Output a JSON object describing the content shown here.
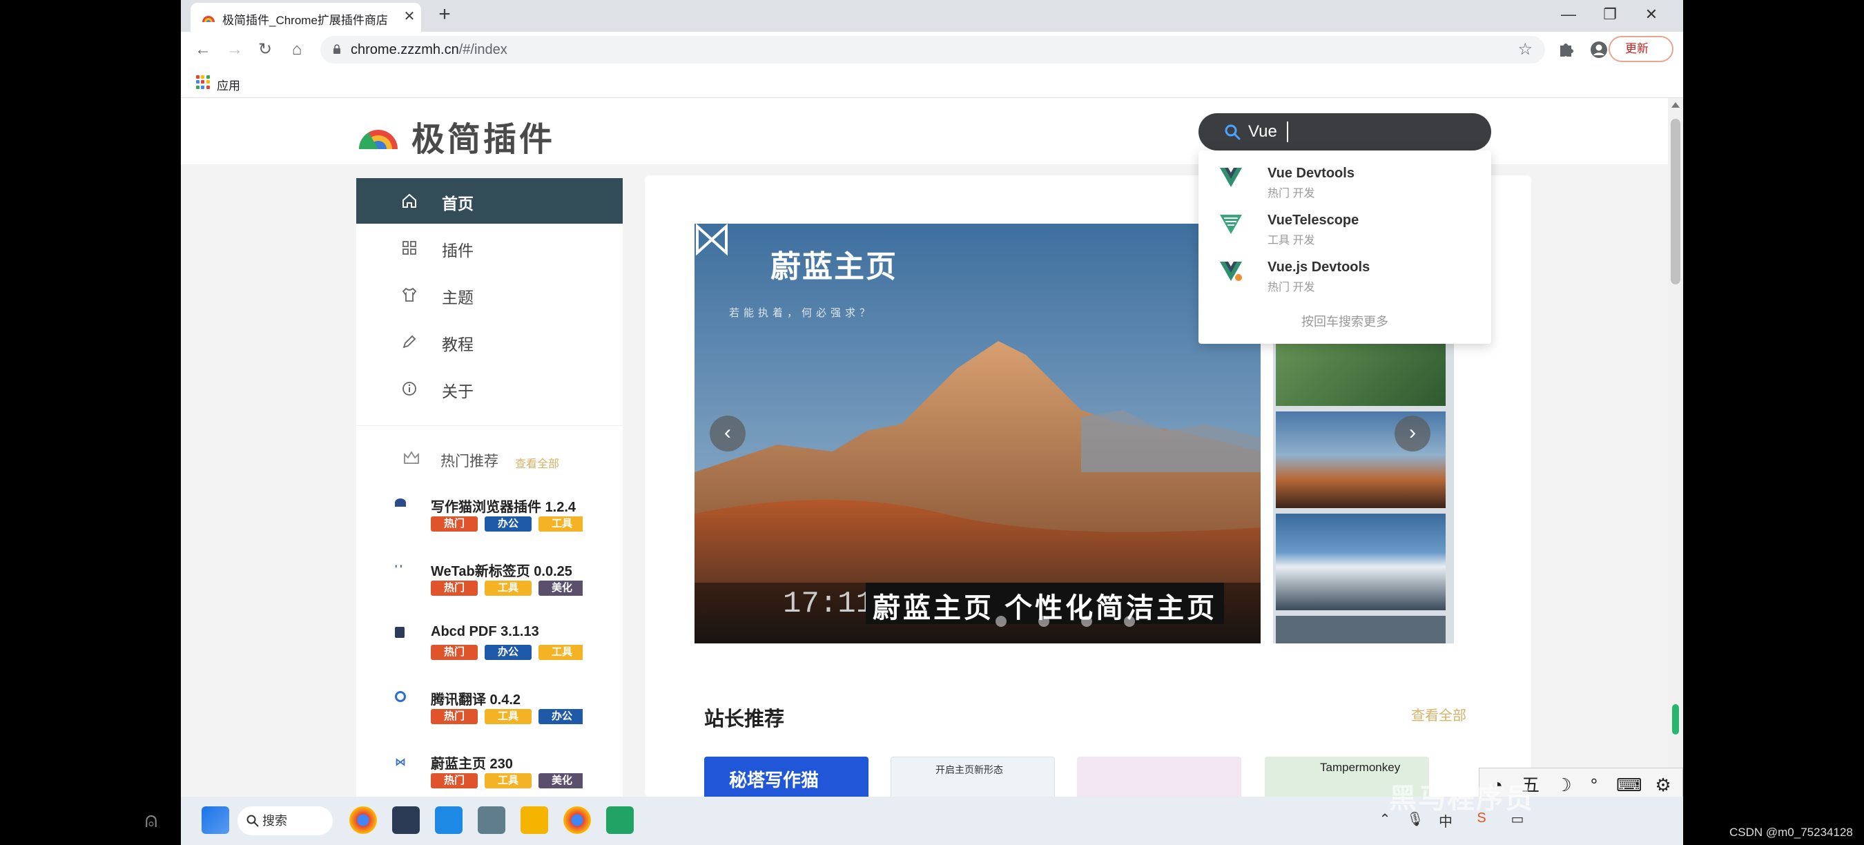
{
  "browser": {
    "tab_title": "极简插件_Chrome扩展插件商店",
    "tab_close": "✕",
    "new_tab": "+",
    "url_host": "chrome.zzzmh.cn",
    "url_path": "/#/index",
    "update_label": "更新",
    "update_menu": "⋮",
    "bookmark_apps": "应用",
    "window_minimize": "—",
    "window_restore": "❐",
    "window_close": "✕"
  },
  "site": {
    "logo_text": "极简插件",
    "search": {
      "value": "Vue",
      "suggestions": [
        {
          "name": "Vue Devtools",
          "tags": "热门 开发",
          "logo_color": "#2f8f6e"
        },
        {
          "name": "VueTelescope",
          "tags": "工具 开发",
          "logo_color": "#3aa57a"
        },
        {
          "name": "Vue.js Devtools",
          "tags": "热门 开发",
          "logo_color": "#2f8f6e"
        }
      ],
      "more": "按回车搜索更多"
    },
    "nav": [
      {
        "label": "首页",
        "icon": "home-icon"
      },
      {
        "label": "插件",
        "icon": "grid-icon"
      },
      {
        "label": "主题",
        "icon": "shirt-icon"
      },
      {
        "label": "教程",
        "icon": "pencil-icon"
      },
      {
        "label": "关于",
        "icon": "info-icon"
      }
    ],
    "hot": {
      "title": "热门推荐",
      "more": "查看全部",
      "plugins": [
        {
          "name": "写作猫浏览器插件 1.2.4",
          "tags": [
            "热门",
            "办公",
            "工具"
          ]
        },
        {
          "name": "WeTab新标签页 0.0.25",
          "tags": [
            "热门",
            "工具",
            "美化"
          ]
        },
        {
          "name": "Abcd PDF 3.1.13",
          "tags": [
            "热门",
            "办公",
            "工具"
          ]
        },
        {
          "name": "腾讯翻译 0.4.2",
          "tags": [
            "热门",
            "工具",
            "办公"
          ]
        },
        {
          "name": "蔚蓝主页 230",
          "tags": [
            "热门",
            "工具",
            "美化"
          ]
        }
      ]
    },
    "banner": {
      "brand": "蔚蓝主页",
      "slogan": "若能执着，何必强求？",
      "time": "17:11",
      "caption": "蔚蓝主页 个性化简洁主页",
      "prev": "‹",
      "next": "›"
    },
    "recommend": {
      "title": "站长推荐",
      "more": "查看全部",
      "cards": [
        {
          "text": "秘塔写作猫"
        },
        {
          "text": "开启主页新形态"
        },
        {
          "text": ""
        },
        {
          "text": "Tampermonkey"
        }
      ]
    }
  },
  "taskbar": {
    "search_label": "搜索",
    "ime_key": "五",
    "watermark": "黑马程序员",
    "tray_ime": "中"
  },
  "overlay": {
    "csdn": "CSDN @m0_75234128"
  }
}
